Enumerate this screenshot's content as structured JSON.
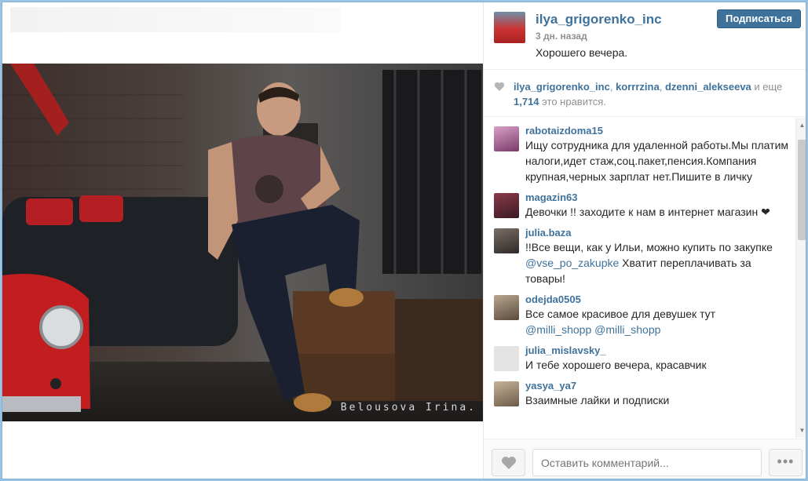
{
  "post": {
    "username": "ilya_grigorenko_inc",
    "time": "3 дн. назад",
    "caption": "Хорошего вечера.",
    "follow_label": "Подписаться",
    "watermark": "Belousova Irina."
  },
  "likes": {
    "user1": "ilya_grigorenko_inc",
    "sep1": ", ",
    "user2": "korrrzina",
    "sep2": ", ",
    "user3": "dzenni_alekseeva",
    "and_more": " и еще",
    "count": "1,714",
    "suffix": " это нравится."
  },
  "comments": [
    {
      "user": "rabotaizdoma15",
      "text": "Ищу сотрудника для удаленной работы.Мы платим налоги,идет стаж,соц.пакет,пенсия.Компания крупная,черных зарплат нет.Пишите в личку",
      "avatar_color": "#b06a9a"
    },
    {
      "user": "magazin63",
      "text": "Девочки !! заходите к нам в интернет магазин ❤",
      "avatar_color": "#6a2e3a"
    },
    {
      "user": "julia.baza",
      "text_before": "!!Все вещи, как у Ильи, можно купить по закупке ",
      "mention": "@vse_po_zakupke",
      "text_after": " Хватит переплачивать за товары!",
      "avatar_color": "#4e4a48"
    },
    {
      "user": "odejda0505",
      "text": "Все самое красивое для девушек  тут ",
      "mention1": "@milli_shopp",
      "mention2": "@milli_shopp",
      "avatar_color": "#8c7a6a"
    },
    {
      "user": "julia_mislavsky_",
      "text": "И тебе хорошего вечера, красавчик",
      "avatar_color": "#e0e0e0"
    },
    {
      "user": "yasya_ya7",
      "text": "Взаимные лайки и подписки",
      "avatar_color": "#9a8a78"
    }
  ],
  "footer": {
    "comment_placeholder": "Оставить комментарий...",
    "more_label": "•••"
  },
  "colors": {
    "link": "#3f729b",
    "follow_bg": "#3f729b",
    "muted": "#8f8f8f"
  }
}
